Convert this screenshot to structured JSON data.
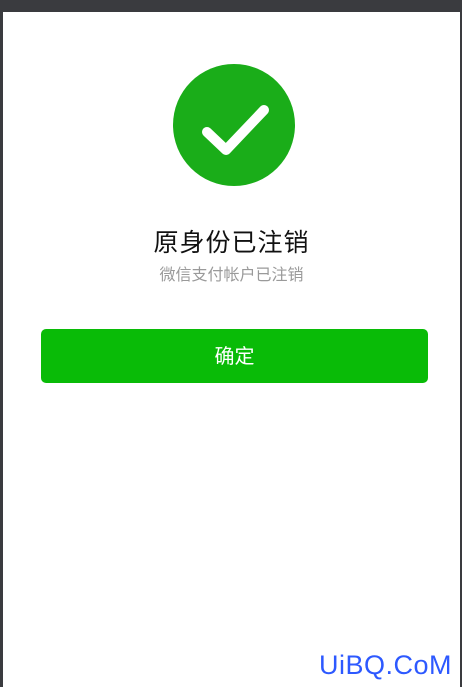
{
  "result": {
    "icon": "check-circle-icon",
    "title": "原身份已注销",
    "subtitle": "微信支付帐户已注销"
  },
  "actions": {
    "confirm_label": "确定"
  },
  "watermark": {
    "text": "UiBQ.CoM"
  },
  "colors": {
    "success_green": "#1aad19",
    "button_green": "#09bb07",
    "title_text": "#111111",
    "subtitle_text": "#9a9a9a",
    "watermark_blue": "#2d59ff"
  }
}
